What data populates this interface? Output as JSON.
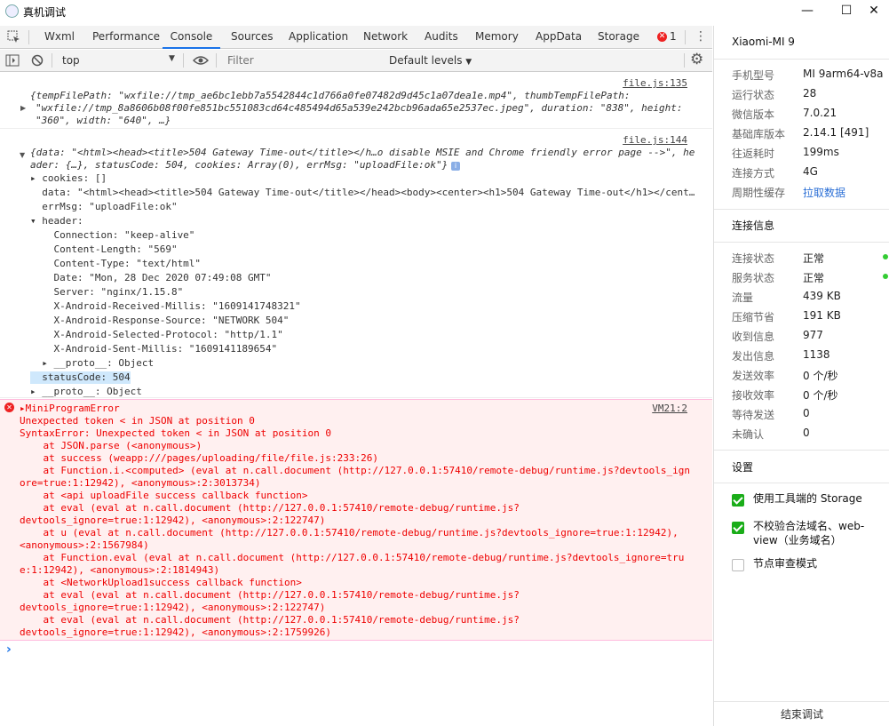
{
  "window": {
    "title": "真机调试",
    "minimize": "—",
    "maximize": "☐",
    "close": "✕"
  },
  "tabs": [
    "Wxml",
    "Performance",
    "Console",
    "Sources",
    "Application",
    "Network",
    "Audits",
    "Memory",
    "AppData",
    "Storage"
  ],
  "active_tab": "Console",
  "error_count": "1",
  "toolbar": {
    "context": "top",
    "filter_placeholder": "Filter",
    "levels": "Default levels"
  },
  "console": {
    "msg1": {
      "source": "file.js:135",
      "line1": "{tempFilePath: \"wxfile://tmp_ae6bc1ebb7a5542844c1d766a0fe07482d9d45c1a07dea1e.mp4\", thumbTempFilePath:",
      "line2": "\"wxfile://tmp_8a8606b08f00fe851bc551083cd64c485494d65a539e242bcb96ada65e2537ec.jpeg\", duration: \"838\", height:",
      "line3": "\"360\", width: \"640\", …}"
    },
    "msg2": {
      "source": "file.js:144",
      "line1": "{data: \"<html><head><title>504 Gateway Time-out</title></h…o disable MSIE and Chrome friendly error page -->\", he",
      "line2": "ader: {…}, statusCode: 504, cookies: Array(0), errMsg: \"uploadFile:ok\"}",
      "items": [
        "▸ cookies: []",
        "  data: \"<html><head><title>504 Gateway Time-out</title></head><body><center><h1>504 Gateway Time-out</h1></cent…",
        "  errMsg: \"uploadFile:ok\"",
        "▾ header:",
        "    Connection: \"keep-alive\"",
        "    Content-Length: \"569\"",
        "    Content-Type: \"text/html\"",
        "    Date: \"Mon, 28 Dec 2020 07:49:08 GMT\"",
        "    Server: \"nginx/1.15.8\"",
        "    X-Android-Received-Millis: \"1609141748321\"",
        "    X-Android-Response-Source: \"NETWORK 504\"",
        "    X-Android-Selected-Protocol: \"http/1.1\"",
        "    X-Android-Sent-Millis: \"1609141189654\"",
        "  ▸ __proto__: Object",
        "  statusCode: 504",
        "▸ __proto__: Object"
      ]
    },
    "error": {
      "source": "VM21:2",
      "lines": [
        "▸MiniProgramError",
        "Unexpected token < in JSON at position 0",
        "SyntaxError: Unexpected token < in JSON at position 0",
        "    at JSON.parse (<anonymous>)",
        "    at success (weapp:///pages/uploading/file/file.js:233:26)",
        "    at Function.i.<computed> (eval at n.call.document (http://127.0.0.1:57410/remote-debug/runtime.js?devtools_ign",
        "ore=true:1:12942), <anonymous>:2:3013734)",
        "    at <api uploadFile success callback function>",
        "    at eval (eval at n.call.document (http://127.0.0.1:57410/remote-debug/runtime.js?",
        "devtools_ignore=true:1:12942), <anonymous>:2:122747)",
        "    at u (eval at n.call.document (http://127.0.0.1:57410/remote-debug/runtime.js?devtools_ignore=true:1:12942),",
        "<anonymous>:2:1567984)",
        "    at Function.eval (eval at n.call.document (http://127.0.0.1:57410/remote-debug/runtime.js?devtools_ignore=tru",
        "e:1:12942), <anonymous>:2:1814943)",
        "    at <NetworkUpload1success callback function>",
        "    at eval (eval at n.call.document (http://127.0.0.1:57410/remote-debug/runtime.js?",
        "devtools_ignore=true:1:12942), <anonymous>:2:122747)",
        "    at eval (eval at n.call.document (http://127.0.0.1:57410/remote-debug/runtime.js?",
        "devtools_ignore=true:1:12942), <anonymous>:2:1759926)"
      ]
    },
    "prompt": "›"
  },
  "panel": {
    "device": "Xiaomi-MI 9",
    "info": [
      {
        "label": "手机型号",
        "value": "MI 9arm64-v8a"
      },
      {
        "label": "运行状态",
        "value": "28"
      },
      {
        "label": "微信版本",
        "value": "7.0.21"
      },
      {
        "label": "基础库版本",
        "value": "2.14.1 [491]"
      },
      {
        "label": "往返耗时",
        "value": "199ms"
      },
      {
        "label": "连接方式",
        "value": "4G"
      },
      {
        "label": "周期性缓存",
        "value": "拉取数据"
      }
    ],
    "conn_title": "连接信息",
    "conn": [
      {
        "label": "连接状态",
        "value": "正常"
      },
      {
        "label": "服务状态",
        "value": "正常"
      },
      {
        "label": "流量",
        "value": "439 KB"
      },
      {
        "label": "压缩节省",
        "value": "191 KB"
      },
      {
        "label": "收到信息",
        "value": "977"
      },
      {
        "label": "发出信息",
        "value": "1138"
      },
      {
        "label": "发送效率",
        "value": "0 个/秒"
      },
      {
        "label": "接收效率",
        "value": "0 个/秒"
      },
      {
        "label": "等待发送",
        "value": "0"
      },
      {
        "label": "未确认",
        "value": "0"
      }
    ],
    "settings_title": "设置",
    "settings": [
      {
        "label": "使用工具端的 Storage",
        "checked": true
      },
      {
        "label": "不校验合法域名、web-view（业务域名）",
        "checked": true
      },
      {
        "label": "节点审查模式",
        "checked": false
      }
    ],
    "end_button": "结束调试",
    "status_color": "#33cc33",
    "link_color": "#2b6fd6"
  }
}
